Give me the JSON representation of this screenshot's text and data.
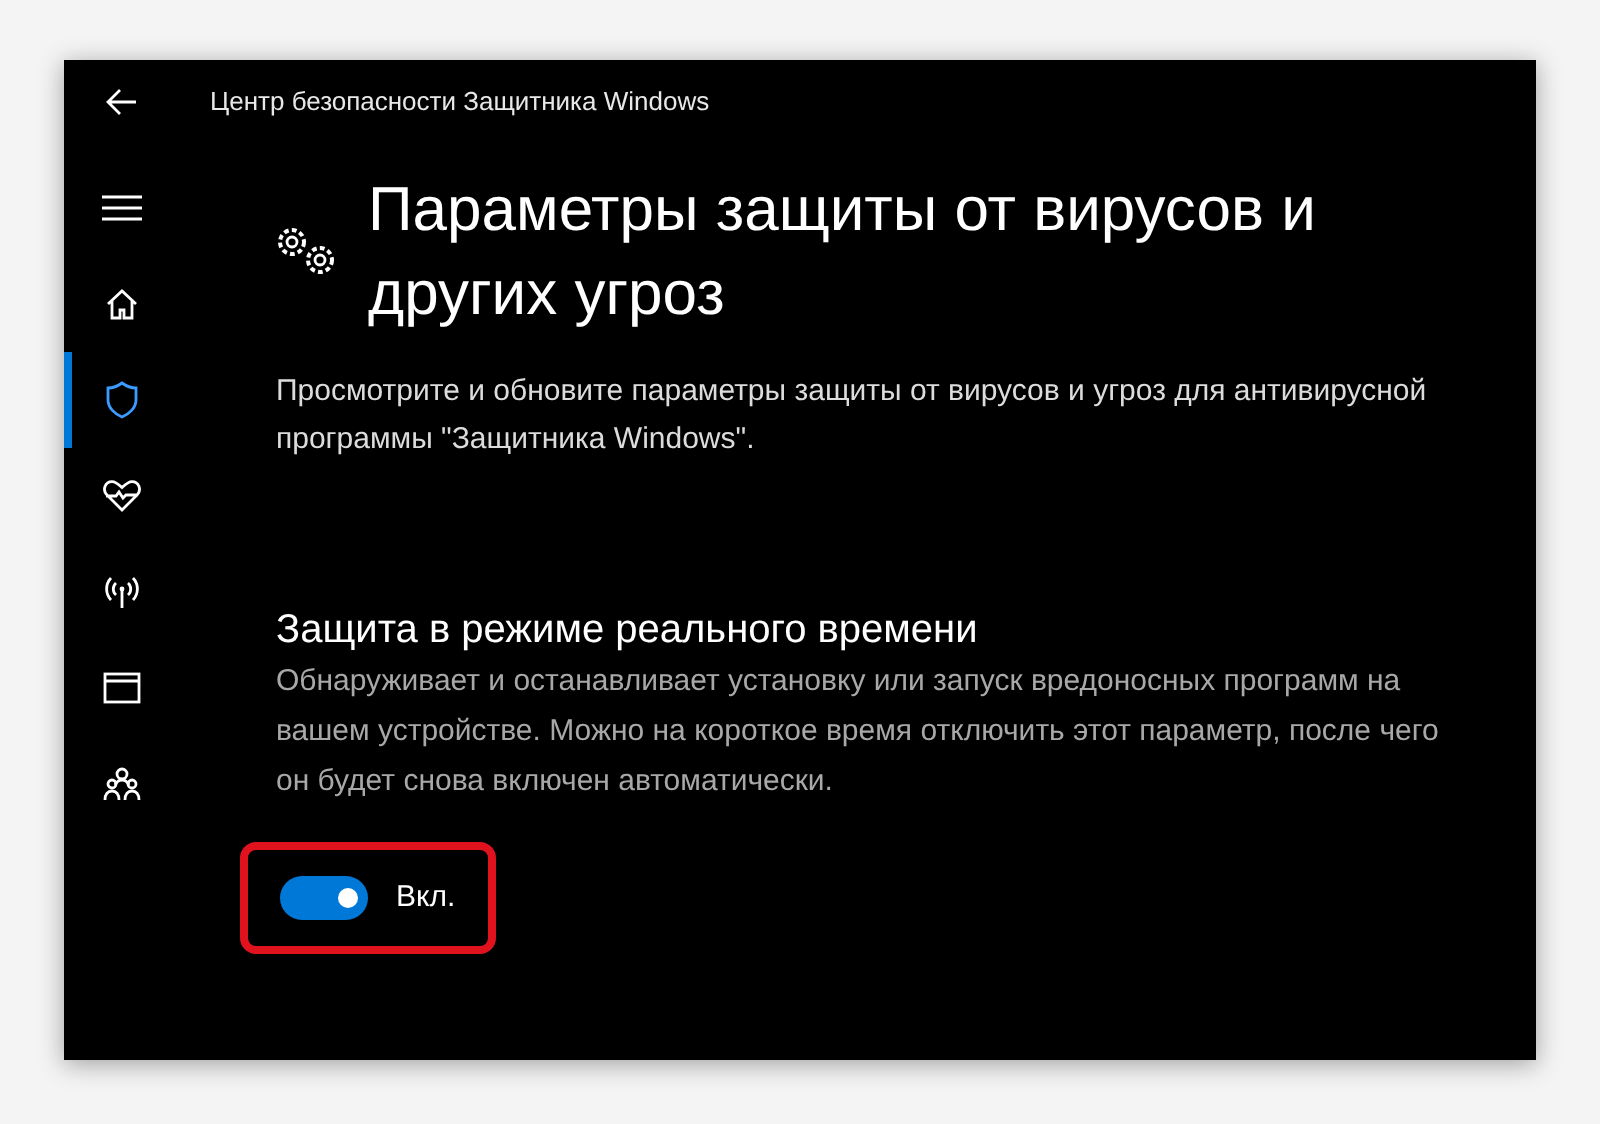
{
  "window": {
    "title": "Центр безопасности Защитника Windows"
  },
  "sidebar": {
    "items": [
      {
        "kind": "home",
        "selected": false
      },
      {
        "kind": "shield",
        "selected": true
      },
      {
        "kind": "health",
        "selected": false
      },
      {
        "kind": "network",
        "selected": false
      },
      {
        "kind": "app",
        "selected": false
      },
      {
        "kind": "family",
        "selected": false
      }
    ]
  },
  "page": {
    "title": "Параметры защиты от вирусов и других угроз",
    "description": "Просмотрите и обновите параметры защиты от вирусов и угроз для антивирусной программы \"Защитника Windows\"."
  },
  "section": {
    "title": "Защита в режиме реального времени",
    "description": "Обнаруживает и останавливает установку или запуск вредоносных программ на вашем устройстве. Можно на короткое время отключить этот параметр, после чего он будет снова включен автоматически.",
    "toggle": {
      "on": true,
      "label": "Вкл."
    }
  }
}
